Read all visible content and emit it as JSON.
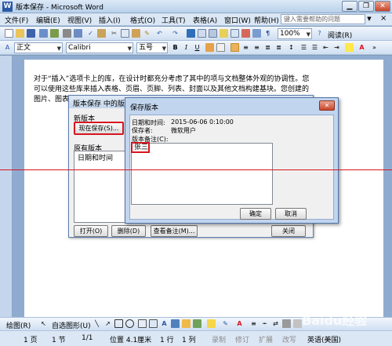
{
  "window": {
    "title": "版本保存 - Microsoft Word",
    "app_icon": "W"
  },
  "menu": {
    "items": [
      "文件(F)",
      "编辑(E)",
      "视图(V)",
      "插入(I)",
      "格式(O)",
      "工具(T)",
      "表格(A)",
      "窗口(W)",
      "帮助(H)"
    ],
    "help_placeholder": "键入需要帮助的问题",
    "close_glyph": "×"
  },
  "toolbar": {
    "zoom": "100%",
    "read_label": "阅读(R)"
  },
  "formatting": {
    "style": "正文",
    "font": "Calibri",
    "size": "五号",
    "bold": "B",
    "italic": "I",
    "underline": "U"
  },
  "document": {
    "lines": [
      "对于“插入”选项卡上的库，在设计时都充分考虑了其中的项与文档整体外观的协调性。您",
      "可以使用这些库来插入表格、页眉、页脚、列表、封面以及其他文档构建基块。您创建的",
      "图片、图表或关系图也将与当前的文档外观协调一致。"
    ]
  },
  "version_dialog": {
    "title": "版本保存 中的版本",
    "new_version_label": "新版本",
    "save_now_button": "现在保存(S)...",
    "existing_label": "原有版本",
    "datetime_header": "日期和时间",
    "open_button": "打开(O)",
    "delete_button": "删除(D)",
    "view_comments_button": "查看备注(M)...",
    "close_button": "关闭"
  },
  "save_dialog": {
    "title": "保存版本",
    "datetime_label": "日期和时间:",
    "datetime_value": "2015-06-06 0:10:00",
    "saved_by_label": "保存者:",
    "saved_by_value": "微软用户",
    "comment_label": "版本备注(C):",
    "comment_value": "张三",
    "ok_button": "确定",
    "cancel_button": "取消"
  },
  "drawing": {
    "draw_label": "绘图(R)",
    "autoshapes_label": "自选图形(U)"
  },
  "status": {
    "page": "1 页",
    "section": "1 节",
    "pages": "1/1",
    "position": "位置 4.1厘米",
    "line": "1 行",
    "col": "1 列",
    "rec": "录制",
    "rev": "修订",
    "ext": "扩展",
    "ovr": "改写",
    "lang": "英语(美国)"
  },
  "watermark": "Baidu经验",
  "colors": {
    "accent_red": "#d8151f",
    "title_blue": "#2b57a6"
  }
}
